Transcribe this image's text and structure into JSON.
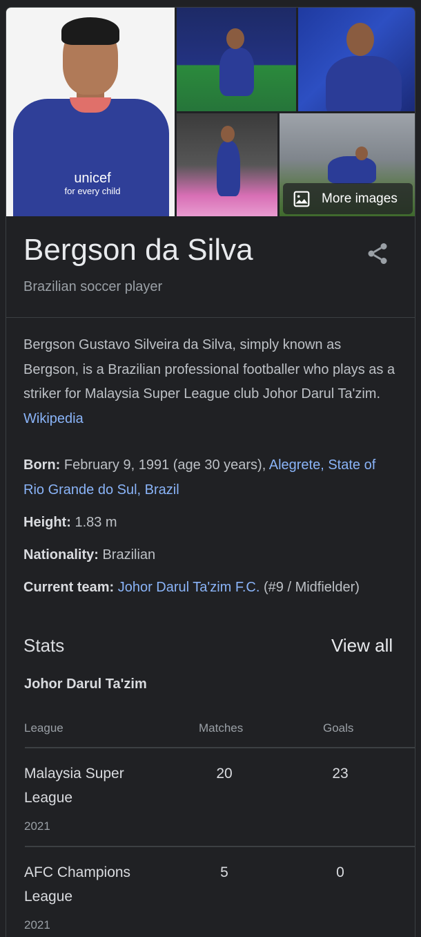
{
  "images": {
    "more_label": "More images",
    "sponsor_main": "unicef",
    "sponsor_sub": "for every child"
  },
  "entity": {
    "name": "Bergson da Silva",
    "type": "Brazilian soccer player"
  },
  "description": {
    "text": "Bergson Gustavo Silveira da Silva, simply known as Bergson, is a Brazilian professional footballer who plays as a striker for Malaysia Super League club Johor Darul Ta'zim.",
    "source_link": "Wikipedia"
  },
  "facts": {
    "born": {
      "label": "Born:",
      "text": "February 9, 1991 (age 30 years),",
      "link": "Alegrete, State of Rio Grande do Sul, Brazil"
    },
    "height": {
      "label": "Height:",
      "value": "1.83 m"
    },
    "nationality": {
      "label": "Nationality:",
      "value": "Brazilian"
    },
    "current_team": {
      "label": "Current team:",
      "link": "Johor Darul Ta'zim F.C.",
      "suffix": "(#9 / Midfielder)"
    }
  },
  "stats": {
    "heading": "Stats",
    "view_all": "View all",
    "team": "Johor Darul Ta'zim",
    "columns": [
      "League",
      "Matches",
      "Goals"
    ],
    "rows": [
      {
        "league": "Malaysia Super League",
        "year": "2021",
        "matches": "20",
        "goals": "23"
      },
      {
        "league": "AFC Champions League",
        "year": "2021",
        "matches": "5",
        "goals": "0"
      }
    ]
  },
  "colors": {
    "background": "#202124",
    "link": "#8ab4f8",
    "text": "#bdc1c6",
    "heading": "#e8eaed"
  }
}
